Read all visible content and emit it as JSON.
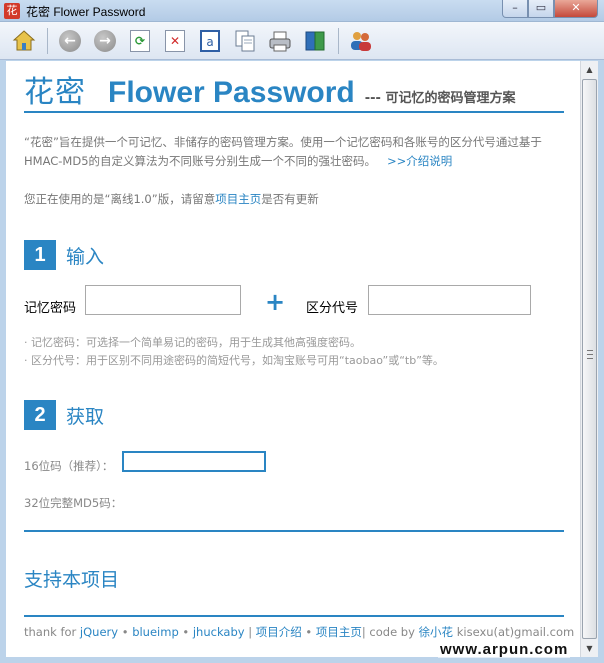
{
  "window": {
    "app_icon_glyph": "花",
    "title": "花密 Flower Password",
    "min_glyph": "–",
    "max_glyph": "▭",
    "close_glyph": "✕"
  },
  "toolbar": {
    "buttons": [
      {
        "name": "home-icon"
      },
      {
        "name": "back-icon",
        "glyph": "←"
      },
      {
        "name": "forward-icon",
        "glyph": "→"
      },
      {
        "name": "refresh-icon",
        "glyph": "⟳"
      },
      {
        "name": "stop-icon",
        "glyph": "✕"
      },
      {
        "name": "text-select-icon",
        "glyph": "a"
      },
      {
        "name": "copy-icon"
      },
      {
        "name": "print-icon"
      },
      {
        "name": "book-icon"
      },
      {
        "name": "users-icon"
      }
    ]
  },
  "header": {
    "cn": "花密",
    "en": "Flower Password",
    "subtitle": "--- 可记忆的密码管理方案"
  },
  "intro": {
    "text": "“花密”旨在提供一个可记忆、非储存的密码管理方案。使用一个记忆密码和各账号的区分代号通过基于HMAC-MD5的自定义算法为不同账号分别生成一个不同的强壮密码。",
    "link": ">>介绍说明"
  },
  "notice": {
    "before": "您正在使用的是“离线1.0”版，请留意",
    "link": "项目主页",
    "after": "是否有更新"
  },
  "section1": {
    "number": "1",
    "title": "输入",
    "password_label": "记忆密码",
    "password_value": "",
    "plus": "+",
    "key_label": "区分代号",
    "key_value": "",
    "hint1": "· 记忆密码：可选择一个简单易记的密码，用于生成其他高强度密码。",
    "hint2": "· 区分代号：用于区别不同用途密码的简短代号，如淘宝账号可用“taobao”或“tb”等。"
  },
  "section2": {
    "number": "2",
    "title": "获取",
    "code16_label": "16位码（推荐）：",
    "code16_value": "",
    "code32_label": "32位完整MD5码："
  },
  "support": {
    "title": "支持本项目"
  },
  "footer": {
    "thanks": "thank for",
    "lib1": "jQuery",
    "bullet": "•",
    "lib2": "blueimp",
    "lib3": "jhuckaby",
    "sep": "|",
    "intro_link": "项目介绍",
    "home_link": "项目主页",
    "code_by": "code by",
    "author": "徐小花",
    "email": "kisexu(at)gmail.com"
  },
  "watermark": "www.arpun.com",
  "colors": {
    "accent": "#2a85c3",
    "chrome": "#bcd3ea"
  }
}
